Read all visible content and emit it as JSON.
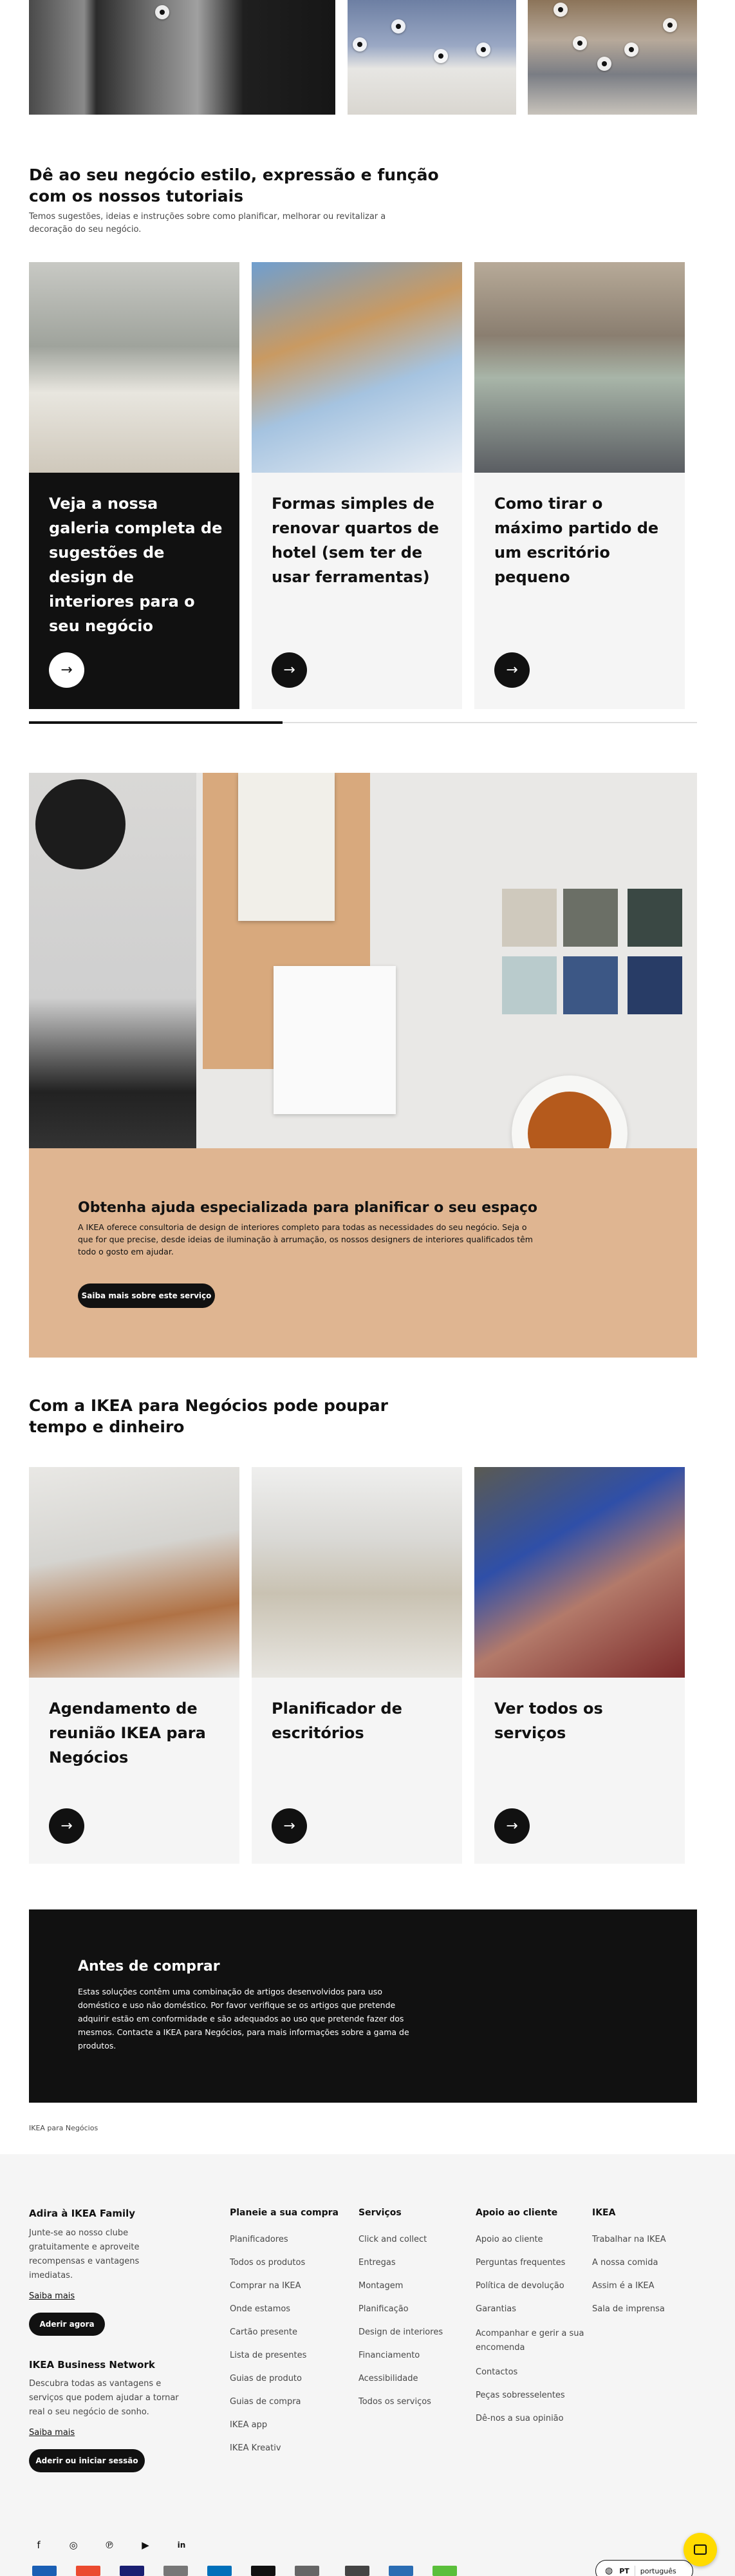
{
  "tutorials": {
    "title": "Dê ao seu negócio estilo, expressão e função com os nossos tutoriais",
    "subtitle": "Temos sugestões, ideias e instruções sobre como planificar, melhorar ou revitalizar a decoração do seu negócio.",
    "cards": [
      {
        "title": "Veja a nossa galeria completa de sugestões de design de interiores para o seu negócio"
      },
      {
        "title": "Formas simples de renovar quartos de hotel (sem ter de usar ferramentas)"
      },
      {
        "title": "Como tirar o máximo partido de um escritório pequeno"
      }
    ],
    "scroll_progress": 0.38
  },
  "expert": {
    "title": "Obtenha ajuda especializada para planificar o seu espaço",
    "text": "A IKEA oferece consultoria de design de interiores completo para todas as necessidades do seu negócio. Seja o que for que precise, desde ideias de iluminação à arrumação, os nossos designers de interiores qualificados têm todo o gosto em ajudar.",
    "button": "Saiba mais sobre este serviço"
  },
  "services": {
    "title": "Com a IKEA para Negócios pode poupar tempo e dinheiro",
    "cards": [
      {
        "title": "Agendamento de reunião IKEA para Negócios"
      },
      {
        "title": "Planificador de escritórios"
      },
      {
        "title": "Ver todos os serviços"
      }
    ]
  },
  "before_buy": {
    "title": "Antes de comprar",
    "text": "Estas soluções contêm uma combinação de artigos desenvolvidos para uso doméstico e uso não doméstico. Por favor verifique se os artigos que pretende adquirir estão em conformidade e são adequados ao uso que pretende fazer dos mesmos. Contacte a IKEA para Negócios, para mais informações sobre a gama de produtos."
  },
  "breadcrumb": "IKEA para Negócios",
  "footer": {
    "family": {
      "title": "Adira à IKEA Family",
      "text": "Junte-se ao nosso clube gratuitamente e aproveite recompensas e vantagens imediatas.",
      "link": "Saiba mais",
      "button": "Aderir agora"
    },
    "business": {
      "title": "IKEA Business Network",
      "text": "Descubra todas as vantagens e serviços que podem ajudar a tornar real o seu negócio de sonho.",
      "link": "Saiba mais",
      "button": "Aderir ou iniciar sessão"
    },
    "columns": [
      {
        "title": "Planeie a sua compra",
        "links": [
          "Planificadores",
          "Todos os produtos",
          "Comprar na IKEA",
          "Onde estamos",
          "Cartão presente",
          "Lista de presentes",
          "Guias de produto",
          "Guias de compra",
          "IKEA app",
          "IKEA Kreativ"
        ]
      },
      {
        "title": "Serviços",
        "links": [
          "Click and collect",
          "Entregas",
          "Montagem",
          "Planificação",
          "Design de interiores",
          "Financiamento",
          "Acessibilidade",
          "Todos os serviços"
        ]
      },
      {
        "title": "Apoio ao cliente",
        "links": [
          "Apoio ao cliente",
          "Perguntas frequentes",
          "Política de devolução",
          "Garantias",
          "Acompanhar e gerir a sua encomenda",
          "Contactos",
          "Peças sobresselentes",
          "Dê-nos a sua opinião"
        ]
      },
      {
        "title": "IKEA",
        "links": [
          "Trabalhar na IKEA",
          "A nossa comida",
          "Assim é a IKEA",
          "Sala de imprensa"
        ]
      }
    ],
    "social_icons": [
      "facebook-icon",
      "instagram-icon",
      "pinterest-icon",
      "youtube-icon",
      "linkedin-icon"
    ],
    "lang_code": "PT",
    "lang_name": "português"
  },
  "colors": {
    "accent_tan": "#dfb591",
    "chat_yellow": "#ffdb00",
    "dark": "#111111"
  }
}
